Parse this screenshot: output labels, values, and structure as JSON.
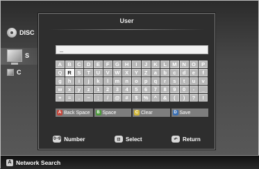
{
  "menu": {
    "disc_label": "DISC",
    "setup_label": "S",
    "c_label": "C"
  },
  "dialog": {
    "title": "User",
    "input_value": "_"
  },
  "keyboard": {
    "rows": [
      [
        "A",
        "B",
        "C",
        "D",
        "E",
        "F",
        "G",
        "H",
        "I",
        "J",
        "K",
        "L",
        "M",
        "N",
        "O",
        "P"
      ],
      [
        "Q",
        "R",
        "S",
        "T",
        "U",
        "V",
        "W",
        "X",
        "Y",
        "Z",
        "a",
        "b",
        "c",
        "d",
        "e",
        "f"
      ],
      [
        "g",
        "h",
        "i",
        "j",
        "k",
        "l",
        "m",
        "n",
        "o",
        "p",
        "q",
        "r",
        "s",
        "t",
        "u",
        "v"
      ],
      [
        "w",
        "x",
        "y",
        "z",
        "1",
        "2",
        "3",
        "4",
        "5",
        "6",
        "7",
        "8",
        "9",
        "0",
        "-",
        "_"
      ],
      [
        "+",
        "=",
        ".",
        "~",
        ":",
        "/",
        "@",
        "#",
        "$",
        "%",
        "^",
        "&",
        "(",
        ")",
        "?",
        "!"
      ]
    ],
    "selected": {
      "row": 1,
      "col": 1
    }
  },
  "function_keys": [
    {
      "badge": "A",
      "label": "Back Space",
      "color": "#c4463b"
    },
    {
      "badge": "B",
      "label": "Space",
      "color": "#4d9a3c"
    },
    {
      "badge": "C",
      "label": "Clear",
      "color": "#d2b73a"
    },
    {
      "badge": "D",
      "label": "Save",
      "color": "#3a6fb4"
    }
  ],
  "hints": {
    "number_icon": "0~9",
    "number_label": "Number",
    "select_label": "Select",
    "return_label": "Return"
  },
  "bottom_bar": {
    "badge": "A",
    "label": "Network Search"
  }
}
